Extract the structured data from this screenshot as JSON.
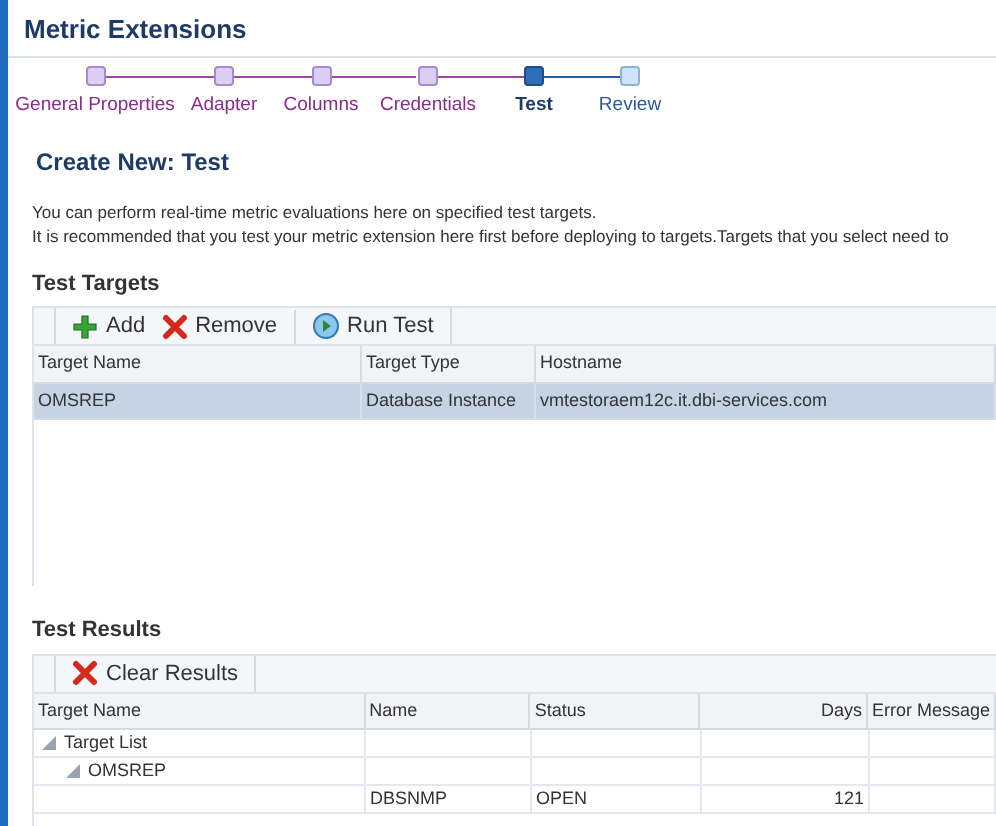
{
  "window": {
    "title": "Metric Extensions"
  },
  "train": [
    {
      "label": "General Properties",
      "visited": true,
      "selected": false
    },
    {
      "label": "Adapter",
      "visited": true,
      "selected": false
    },
    {
      "label": "Columns",
      "visited": true,
      "selected": false
    },
    {
      "label": "Credentials",
      "visited": true,
      "selected": false
    },
    {
      "label": "Test",
      "selected": true
    },
    {
      "label": "Review",
      "visited": false,
      "selected": false
    }
  ],
  "page_title": "Create New: Test",
  "description": [
    "You can perform real-time metric evaluations here on specified test targets.",
    "It is recommended that you test your metric extension here first before deploying to targets.Targets that you select need to"
  ],
  "test_targets": {
    "title": "Test Targets",
    "toolbar": [
      {
        "kind": "add",
        "label": "Add"
      },
      {
        "kind": "remove",
        "label": "Remove"
      },
      {
        "kind": "run",
        "label": "Run Test"
      }
    ],
    "columns": [
      "Target Name",
      "Target Type",
      "Hostname"
    ],
    "rows": [
      {
        "cells": [
          "OMSREP",
          "Database Instance",
          "vmtestoraem12c.it.dbi-services.com"
        ],
        "selected": true
      }
    ]
  },
  "test_results": {
    "title": "Test Results",
    "toolbar": [
      {
        "kind": "remove",
        "label": "Clear Results"
      }
    ],
    "columns": [
      "Target Name",
      "Name",
      "Status",
      "Days",
      "Error Message"
    ],
    "rows": [
      {
        "label": "Target List",
        "expanded": true,
        "children": [
          {
            "label": "OMSREP",
            "expanded": true,
            "children": [
              {
                "name": "DBSNMP",
                "status": "OPEN",
                "days": "121"
              }
            ]
          }
        ]
      }
    ]
  }
}
